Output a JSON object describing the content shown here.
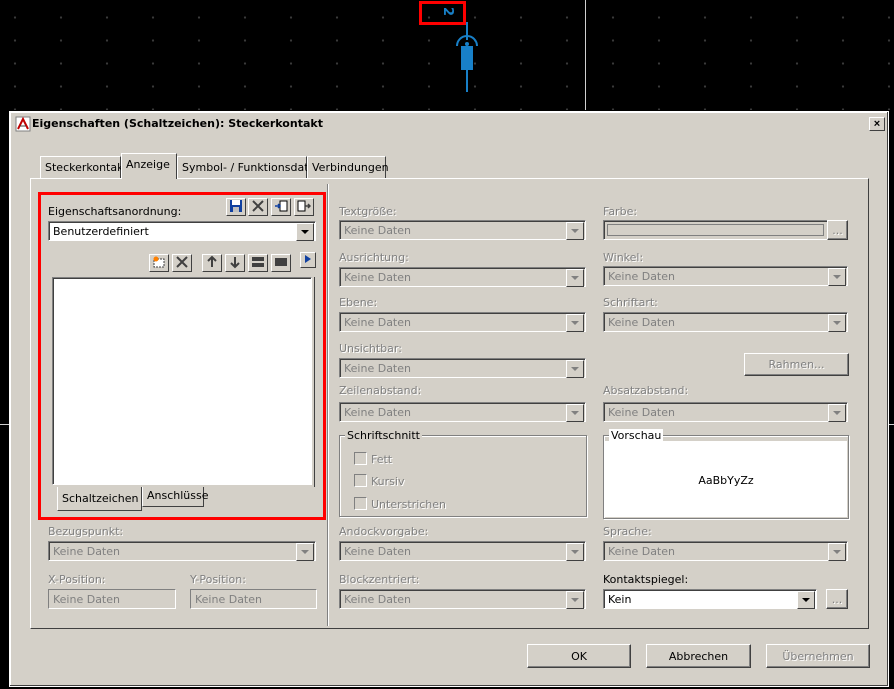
{
  "canvas": {
    "symbol_label": "2"
  },
  "dialog": {
    "title": "Eigenschaften (Schaltzeichen): Steckerkontakt",
    "close_label": "×",
    "tabs": [
      "Steckerkontakt",
      "Anzeige",
      "Symbol- / Funktionsdaten",
      "Verbindungen"
    ],
    "active_tab": "Anzeige"
  },
  "left_panel": {
    "property_arrangement_label": "Eigenschaftsanordnung:",
    "property_arrangement_value": "Benutzerdefiniert",
    "bottom_tabs": [
      "Schaltzeichen",
      "Anschlüsse"
    ],
    "reference_point_label": "Bezugspunkt:",
    "reference_point_value": "Keine Daten",
    "x_position_label": "X-Position:",
    "x_position_value": "Keine Daten",
    "y_position_label": "Y-Position:",
    "y_position_value": "Keine Daten"
  },
  "fields": {
    "text_size": {
      "label": "Textgröße:",
      "value": "Keine Daten"
    },
    "alignment": {
      "label": "Ausrichtung:",
      "value": "Keine Daten"
    },
    "layer": {
      "label": "Ebene:",
      "value": "Keine Daten"
    },
    "invisible": {
      "label": "Unsichtbar:",
      "value": "Keine Daten"
    },
    "line_spacing": {
      "label": "Zeilenabstand:",
      "value": "Keine Daten"
    },
    "docking": {
      "label": "Andockvorgabe:",
      "value": "Keine Daten"
    },
    "block_centered": {
      "label": "Blockzentriert:",
      "value": "Keine Daten"
    },
    "color": {
      "label": "Farbe:",
      "button": "..."
    },
    "angle": {
      "label": "Winkel:",
      "value": "Keine Daten"
    },
    "font": {
      "label": "Schriftart:",
      "value": "Keine Daten"
    },
    "frame_button": "Rahmen...",
    "paragraph_spacing": {
      "label": "Absatzabstand:",
      "value": "Keine Daten"
    },
    "language": {
      "label": "Sprache:",
      "value": "Keine Daten"
    },
    "contact_mirror": {
      "label": "Kontaktspiegel:",
      "value": "Kein",
      "button": "..."
    }
  },
  "font_style": {
    "title": "Schriftschnitt",
    "bold": "Fett",
    "italic": "Kursiv",
    "underline": "Unterstrichen"
  },
  "preview": {
    "title": "Vorschau",
    "sample": "AaBbYyZz"
  },
  "footer": {
    "ok": "OK",
    "cancel": "Abbrechen",
    "apply": "Übernehmen"
  },
  "colors": {
    "highlight": "#ff0000",
    "symbol": "#1880c8",
    "dialog_bg": "#d4d0c8"
  }
}
